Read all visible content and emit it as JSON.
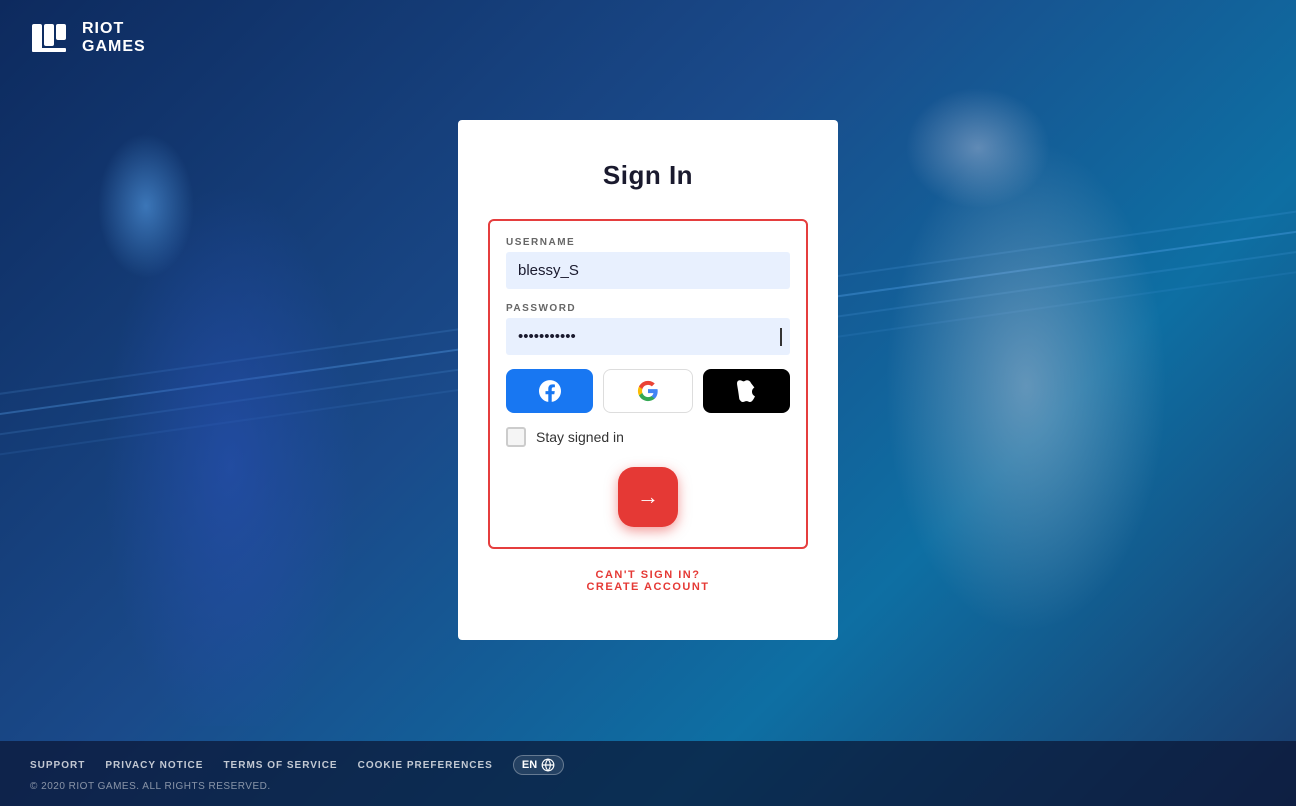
{
  "logo": {
    "text_line1": "RIOT",
    "text_line2": "GAMES"
  },
  "card": {
    "title": "Sign In",
    "username_label": "USERNAME",
    "username_value": "blessy_S",
    "password_label": "PASSWORD",
    "password_value": "••••••••••••",
    "stay_signed_label": "Stay signed in",
    "submit_aria": "Submit",
    "cant_sign_in": "CAN'T SIGN IN?",
    "create_account": "CREATE ACCOUNT"
  },
  "social": {
    "facebook_aria": "Sign in with Facebook",
    "google_aria": "Sign in with Google",
    "apple_aria": "Sign in with Apple"
  },
  "footer": {
    "support": "SUPPORT",
    "privacy": "PRIVACY NOTICE",
    "terms": "TERMS OF SERVICE",
    "cookies": "COOKIE PREFERENCES",
    "lang": "EN",
    "copyright": "© 2020 RIOT GAMES. ALL RIGHTS RESERVED."
  }
}
